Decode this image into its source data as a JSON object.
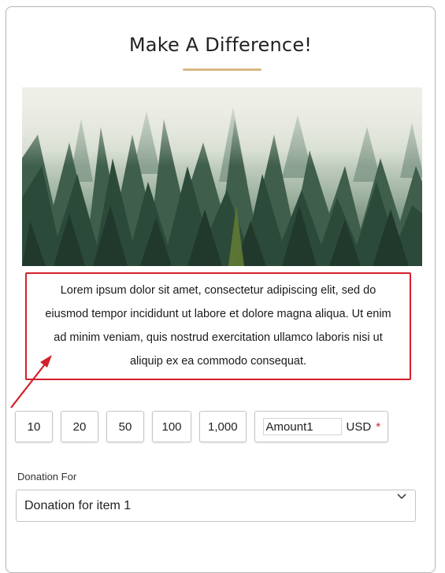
{
  "header": {
    "title": "Make A Difference!",
    "accent_color": "#d8b882"
  },
  "hero": {
    "icon": "misty-forest-image"
  },
  "description": {
    "text": "Lorem ipsum dolor sit amet, consectetur adipiscing elit, sed do eiusmod tempor incididunt ut labore et dolore magna aliqua. Ut enim ad minim veniam, quis nostrud exercitation ullamco laboris nisi ut aliquip ex ea commodo consequat.",
    "highlight_color": "#d3202a"
  },
  "amounts": {
    "options": [
      "10",
      "20",
      "50",
      "100",
      "1,000"
    ],
    "custom_value": "Amount1",
    "currency": "USD",
    "required_marker": "*"
  },
  "donation_for": {
    "label": "Donation For",
    "selected": "Donation for item 1"
  }
}
